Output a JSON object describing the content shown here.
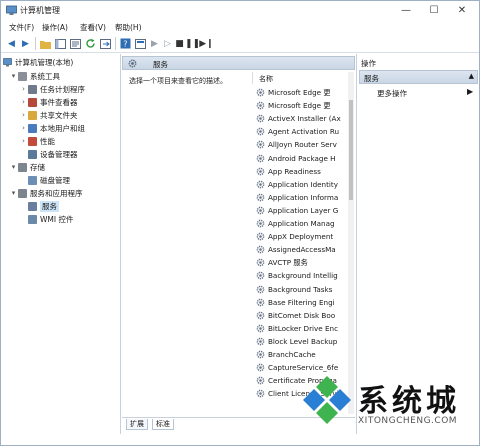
{
  "window": {
    "title": "计算机管理",
    "controls": {
      "minimize": "—",
      "maximize": "☐",
      "close": "✕"
    }
  },
  "menu": [
    "文件(F)",
    "操作(A)",
    "查看(V)",
    "帮助(H)"
  ],
  "tree": {
    "root": "计算机管理(本地)",
    "items": [
      {
        "label": "系统工具",
        "level": 1,
        "expanded": true,
        "color": "#8a8f99"
      },
      {
        "label": "任务计划程序",
        "level": 2,
        "expanded": false,
        "color": "#6f7a8a"
      },
      {
        "label": "事件查看器",
        "level": 2,
        "expanded": false,
        "color": "#b54a3a"
      },
      {
        "label": "共享文件夹",
        "level": 2,
        "expanded": false,
        "color": "#d9a73b"
      },
      {
        "label": "本地用户和组",
        "level": 2,
        "expanded": false,
        "color": "#4b7bbf"
      },
      {
        "label": "性能",
        "level": 2,
        "expanded": false,
        "color": "#c24b3b"
      },
      {
        "label": "设备管理器",
        "level": 2,
        "expanded": null,
        "color": "#5a7a9a"
      },
      {
        "label": "存储",
        "level": 1,
        "expanded": true,
        "color": "#7d858f"
      },
      {
        "label": "磁盘管理",
        "level": 2,
        "expanded": null,
        "color": "#6b8fb5"
      },
      {
        "label": "服务和应用程序",
        "level": 1,
        "expanded": true,
        "color": "#7d858f"
      },
      {
        "label": "服务",
        "level": 2,
        "expanded": null,
        "color": "#6a7fa0",
        "selected": true
      },
      {
        "label": "WMI 控件",
        "level": 2,
        "expanded": null,
        "color": "#6a8aa8"
      }
    ]
  },
  "middle": {
    "header": "服务",
    "description": "选择一个项目来查看它的描述。",
    "column_name": "名称",
    "services": [
      "Microsoft Edge 更",
      "Microsoft Edge 更",
      "ActiveX Installer (Ax",
      "Agent Activation Ru",
      "AllJoyn Router Serv",
      "Android Package H",
      "App Readiness",
      "Application Identity",
      "Application Informa",
      "Application Layer G",
      "Application Manag",
      "AppX Deployment",
      "AssignedAccessMa",
      "AVCTP 服务",
      "Background Intellig",
      "Background Tasks",
      "Base Filtering Engi",
      "BitComet Disk Boo",
      "BitLocker Drive Enc",
      "Block Level Backup",
      "BranchCache",
      "CaptureService_6fe",
      "Certificate Propaga",
      "Client License Servi"
    ],
    "tabs": [
      "扩展",
      "标准"
    ]
  },
  "actions": {
    "title": "操作",
    "section": "服务",
    "more": "更多操作"
  },
  "watermark": {
    "text": "系统城",
    "url": "XITONGCHENG.COM"
  },
  "colors": {
    "accent": "#2e8fd6",
    "header_bg": "#c9d6e5",
    "wm_green": "#3fb34f",
    "wm_blue": "#2a7fd4"
  }
}
